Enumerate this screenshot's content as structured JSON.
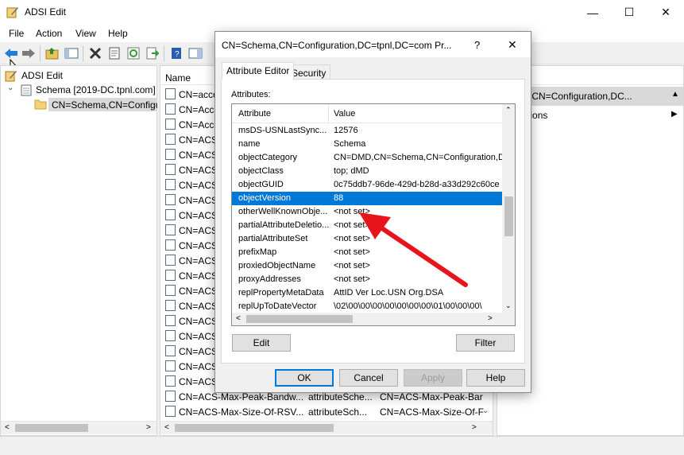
{
  "window": {
    "title": "ADSI Edit",
    "minimize": "—",
    "maximize": "☐",
    "close": "✕"
  },
  "menu": [
    "File",
    "Action",
    "View",
    "Help"
  ],
  "tree": {
    "root": "ADSI Edit",
    "child": "Schema [2019-DC.tpnl.com]",
    "grandchild": "CN=Schema,CN=Configu"
  },
  "list": {
    "header_name": "Name",
    "rows": [
      {
        "name": "CN=acco",
        "class": "",
        "dn": ""
      },
      {
        "name": "CN=Acco",
        "class": "",
        "dn": ""
      },
      {
        "name": "CN=Acco",
        "class": "",
        "dn": ""
      },
      {
        "name": "CN=ACS",
        "class": "",
        "dn": ""
      },
      {
        "name": "CN=ACS",
        "class": "",
        "dn": ""
      },
      {
        "name": "CN=ACS",
        "class": "",
        "dn": ""
      },
      {
        "name": "CN=ACS",
        "class": "",
        "dn": ""
      },
      {
        "name": "CN=ACS",
        "class": "",
        "dn": ""
      },
      {
        "name": "CN=ACS",
        "class": "",
        "dn": ""
      },
      {
        "name": "CN=ACS",
        "class": "",
        "dn": ""
      },
      {
        "name": "CN=ACS",
        "class": "",
        "dn": ""
      },
      {
        "name": "CN=ACS",
        "class": "",
        "dn": ""
      },
      {
        "name": "CN=ACS",
        "class": "",
        "dn": ""
      },
      {
        "name": "CN=ACS",
        "class": "",
        "dn": ""
      },
      {
        "name": "CN=ACS",
        "class": "",
        "dn": ""
      },
      {
        "name": "CN=ACS",
        "class": "",
        "dn": ""
      },
      {
        "name": "CN=ACS",
        "class": "",
        "dn": ""
      },
      {
        "name": "CN=ACS",
        "class": "",
        "dn": ""
      },
      {
        "name": "CN=ACS",
        "class": "",
        "dn": ""
      },
      {
        "name": "CN=ACS",
        "class": "",
        "dn": ""
      },
      {
        "name": "CN=ACS-Max-Peak-Bandw...",
        "class": "attributeSche...",
        "dn": "CN=ACS-Max-Peak-Bar"
      },
      {
        "name": "CN=ACS-Max-Size-Of-RSV...",
        "class": "attributeSch...",
        "dn": "CN=ACS-Max-Size-Of-F"
      }
    ]
  },
  "actions": {
    "header": "s",
    "selected": "chema,CN=Configuration,DC...",
    "more": "ore Actions"
  },
  "dialog": {
    "title": "CN=Schema,CN=Configuration,DC=tpnl,DC=com Pr...",
    "help": "?",
    "close": "✕",
    "tabs": [
      "Attribute Editor",
      "Security"
    ],
    "attributes_label": "Attributes:",
    "col_attribute": "Attribute",
    "col_value": "Value",
    "rows": [
      {
        "attr": "msDS-USNLastSync...",
        "value": "12576"
      },
      {
        "attr": "name",
        "value": "Schema"
      },
      {
        "attr": "objectCategory",
        "value": "CN=DMD,CN=Schema,CN=Configuration,DC"
      },
      {
        "attr": "objectClass",
        "value": "top; dMD"
      },
      {
        "attr": "objectGUID",
        "value": "0c75ddb7-96de-429d-b28d-a33d292c60ce"
      },
      {
        "attr": "objectVersion",
        "value": "88"
      },
      {
        "attr": "otherWellKnownObje...",
        "value": "<not set>"
      },
      {
        "attr": "partialAttributeDeletio...",
        "value": "<not set>"
      },
      {
        "attr": "partialAttributeSet",
        "value": "<not set>"
      },
      {
        "attr": "prefixMap",
        "value": "<not set>"
      },
      {
        "attr": "proxiedObjectName",
        "value": "<not set>"
      },
      {
        "attr": "proxyAddresses",
        "value": "<not set>"
      },
      {
        "attr": "replPropertyMetaData",
        "value": "AttID  Ver    Loc.USN                Org.DSA"
      },
      {
        "attr": "replUpToDateVector",
        "value": "\\02\\00\\00\\00\\00\\00\\00\\00\\01\\00\\00\\00\\"
      }
    ],
    "edit": "Edit",
    "filter": "Filter",
    "ok": "OK",
    "cancel": "Cancel",
    "apply": "Apply",
    "help_btn": "Help",
    "selected_color": "#0078d7",
    "arrow_color": "#e8141c"
  }
}
